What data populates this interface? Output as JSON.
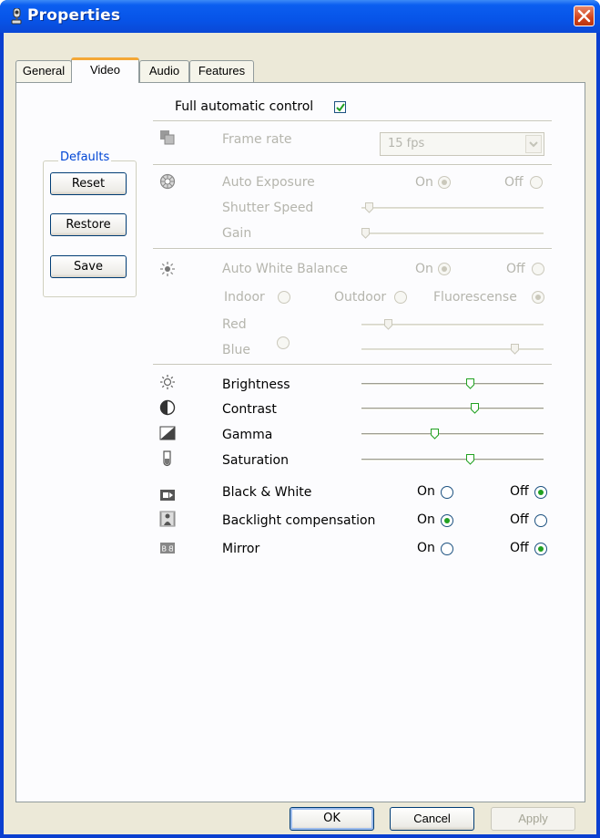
{
  "window": {
    "title": "Properties"
  },
  "tabs": [
    {
      "label": "General",
      "active": false
    },
    {
      "label": "Video",
      "active": true
    },
    {
      "label": "Audio",
      "active": false
    },
    {
      "label": "Features",
      "active": false
    }
  ],
  "full_auto": {
    "label": "Full automatic control",
    "checked": true
  },
  "defaults": {
    "title": "Defaults",
    "reset_label": "Reset",
    "restore_label": "Restore",
    "save_label": "Save"
  },
  "frame_rate": {
    "label": "Frame rate",
    "value": "15 fps",
    "enabled": false
  },
  "exposure": {
    "label": "Auto Exposure",
    "on_label": "On",
    "off_label": "Off",
    "selected": "on",
    "enabled": false,
    "shutter_label": "Shutter Speed",
    "shutter_value": 0.02,
    "gain_label": "Gain",
    "gain_value": 0.0
  },
  "white_balance": {
    "label": "Auto White Balance",
    "on_label": "On",
    "off_label": "Off",
    "selected": "on",
    "enabled": false,
    "indoor_label": "Indoor",
    "outdoor_label": "Outdoor",
    "fluorescense_label": "Fluorescense",
    "preset": "fluorescense",
    "red_label": "Red",
    "red_value": 0.13,
    "blue_label": "Blue",
    "blue_value": 0.86
  },
  "sliders": [
    {
      "label": "Brightness",
      "value": 0.6
    },
    {
      "label": "Contrast",
      "value": 0.63
    },
    {
      "label": "Gamma",
      "value": 0.4
    },
    {
      "label": "Saturation",
      "value": 0.6
    }
  ],
  "toggles": [
    {
      "label": "Black & White",
      "on_label": "On",
      "off_label": "Off",
      "selected": "off"
    },
    {
      "label": "Backlight compensation",
      "on_label": "On",
      "off_label": "Off",
      "selected": "on"
    },
    {
      "label": "Mirror",
      "on_label": "On",
      "off_label": "Off",
      "selected": "off"
    }
  ],
  "footer": {
    "ok_label": "OK",
    "cancel_label": "Cancel",
    "apply_label": "Apply"
  },
  "colors": {
    "titlebar": "#0754e8",
    "tab_highlight": "#f4a836",
    "check": "#21a121",
    "group_title": "#0046d5"
  }
}
